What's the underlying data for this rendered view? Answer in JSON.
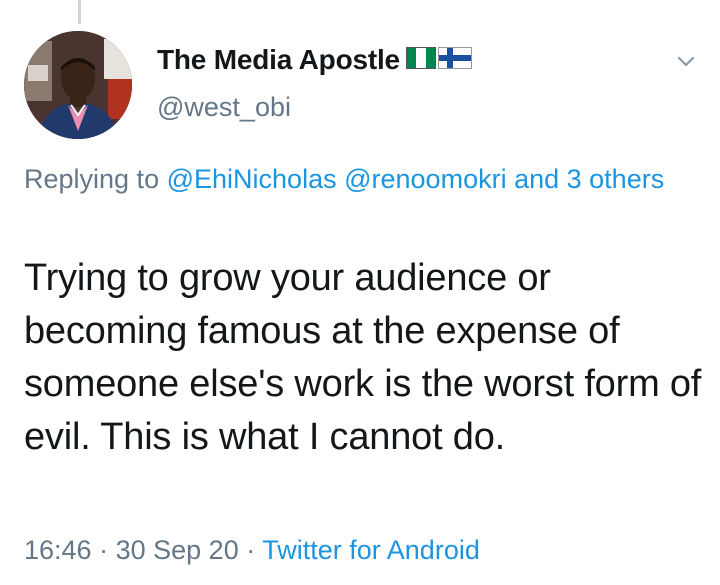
{
  "tweet": {
    "author": {
      "display_name": "The Media Apostle",
      "handle": "@west_obi",
      "flags": [
        "nigeria-flag-icon",
        "finland-flag-icon"
      ]
    },
    "reply": {
      "prefix": "Replying to",
      "mentions": [
        "@EhiNicholas",
        "@renoomokri"
      ],
      "others": "and 3 others"
    },
    "text": "Trying to grow your audience or becoming famous at the expense of someone else's work is the worst form of evil. This is what I cannot do.",
    "meta": {
      "time": "16:46",
      "separator": "·",
      "date": "30 Sep 20",
      "source": "Twitter for Android"
    }
  },
  "colors": {
    "link": "#1b95e0",
    "secondary": "#657786",
    "primary_text": "#14171a"
  },
  "icons": {
    "menu": "chevron-down-icon"
  }
}
